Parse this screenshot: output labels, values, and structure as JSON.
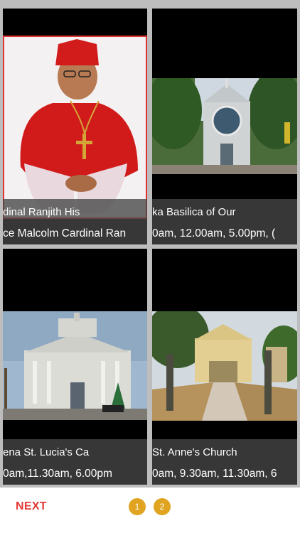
{
  "cards": [
    {
      "title": "dinal Ranjith        His",
      "subtitle": "ce Malcolm Cardinal Ran",
      "photo": "portrait-of-cardinal"
    },
    {
      "title": "ka          Basilica of Our",
      "subtitle": "0am, 12.00am, 5.00pm, (",
      "photo": "church-facade-with-trees"
    },
    {
      "title": "ena          St. Lucia's Ca",
      "subtitle": "0am,11.30am, 6.00pm",
      "photo": "white-cathedral"
    },
    {
      "title": "            St. Anne's Church",
      "subtitle": "0am, 9.30am, 11.30am, 6",
      "photo": "church-with-pathway"
    }
  ],
  "navigation": {
    "next_label": "NEXT",
    "pages": [
      "1",
      "2"
    ]
  },
  "colors": {
    "accent": "#e53935",
    "page_dot": "#e0a421"
  }
}
